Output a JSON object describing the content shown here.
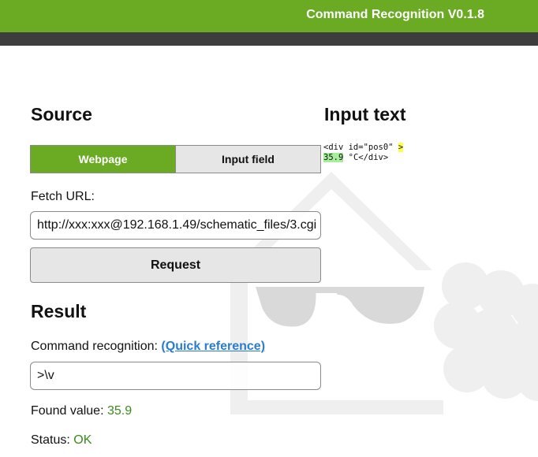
{
  "header": {
    "title": "Command Recognition V0.1.8"
  },
  "source": {
    "heading": "Source",
    "tabs": [
      {
        "label": "Webpage",
        "active": true
      },
      {
        "label": "Input field",
        "active": false
      }
    ],
    "fetch_label": "Fetch URL:",
    "url_value": "http://xxx:xxx@192.168.1.49/schematic_files/3.cgi",
    "request_label": "Request"
  },
  "input_text": {
    "heading": "Input text",
    "line1": "<div id=\"pos0\" ",
    "line1_highlight": ">",
    "line2_highlight": "35.9",
    "line2": " °C</div>"
  },
  "result": {
    "heading": "Result",
    "command_label": "Command recognition:",
    "quick_reference": "(Quick reference)",
    "command_value": ">\\v",
    "found_label": "Found value:",
    "found_value": "35.9",
    "status_label": "Status:",
    "status_value": "OK"
  },
  "colors": {
    "accent": "#6aab23",
    "dark_bar": "#3d3d3d",
    "link": "#2a7ccf",
    "value_green": "#3b8a1c"
  }
}
